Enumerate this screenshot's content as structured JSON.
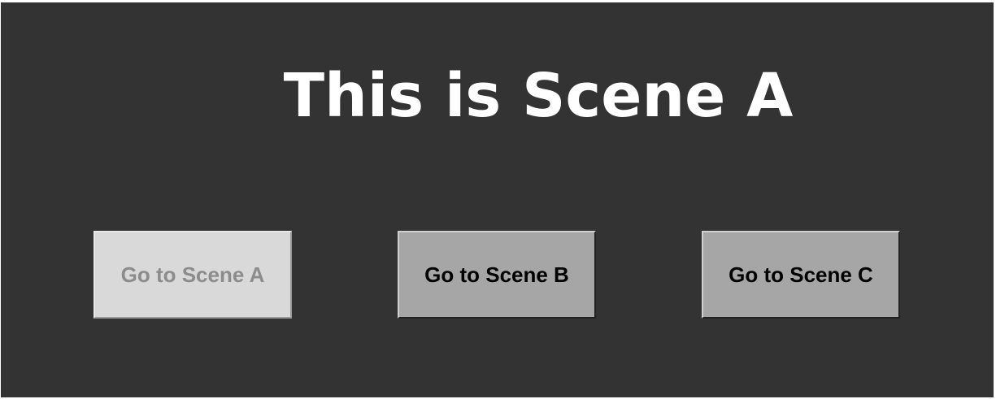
{
  "scene": {
    "title": "This is Scene A"
  },
  "buttons": [
    {
      "label": "Go to Scene A",
      "enabled": false
    },
    {
      "label": "Go to Scene B",
      "enabled": true
    },
    {
      "label": "Go to Scene C",
      "enabled": true
    }
  ],
  "colors": {
    "background": "#333333",
    "title_text": "#ffffff",
    "button_disabled_bg": "#d9d9d9",
    "button_disabled_text": "#8c8c8c",
    "button_bg": "#a6a6a6",
    "button_text": "#000000"
  }
}
